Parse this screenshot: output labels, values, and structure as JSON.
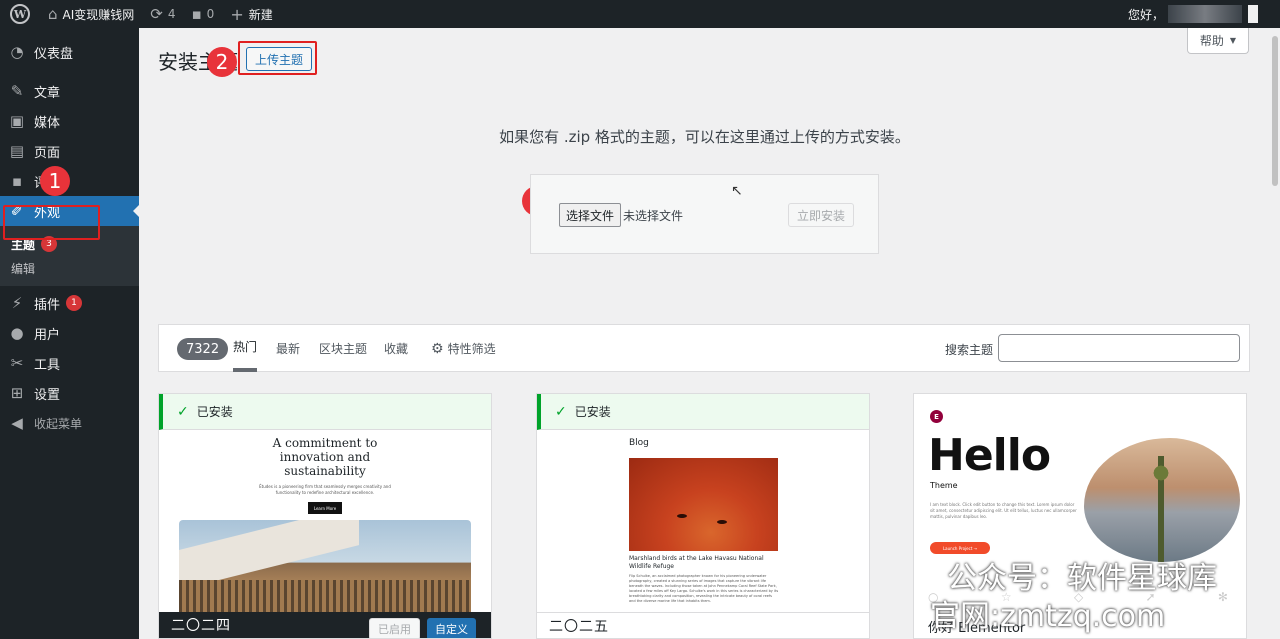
{
  "adminbar": {
    "site_name": "AI变现赚钱网",
    "updates_count": "4",
    "comments_count": "0",
    "new_label": "新建",
    "howdy": "您好，"
  },
  "sidebar": {
    "items": [
      {
        "label": "仪表盘",
        "icon": "dashboard-icon"
      },
      {
        "label": "文章",
        "icon": "pin-icon"
      },
      {
        "label": "媒体",
        "icon": "media-icon"
      },
      {
        "label": "页面",
        "icon": "page-icon"
      },
      {
        "label": "评",
        "icon": "comment-icon"
      },
      {
        "label": "外观",
        "icon": "brush-icon"
      },
      {
        "label": "插件",
        "icon": "plugin-icon",
        "badge": "1"
      },
      {
        "label": "用户",
        "icon": "user-icon"
      },
      {
        "label": "工具",
        "icon": "wrench-icon"
      },
      {
        "label": "设置",
        "icon": "settings-icon"
      },
      {
        "label": "收起菜单",
        "icon": "collapse-icon"
      }
    ],
    "submenu": [
      {
        "label": "主题",
        "badge": "3"
      },
      {
        "label": "编辑"
      }
    ]
  },
  "header": {
    "title": "安装主题",
    "upload_button": "上传主题",
    "help": "帮助"
  },
  "annotations": [
    "1",
    "2",
    "3"
  ],
  "upload": {
    "description": "如果您有 .zip 格式的主题，可以在这里通过上传的方式安装。",
    "choose_file": "选择文件",
    "no_file": "未选择文件",
    "install_now": "立即安装"
  },
  "filter": {
    "count": "7322",
    "tabs": [
      "热门",
      "最新",
      "区块主题",
      "收藏",
      "特性筛选"
    ],
    "search_label": "搜索主题"
  },
  "themes": [
    {
      "status": "已安装",
      "headline": "A commitment to innovation and sustainability",
      "subtext": "Études is a pioneering firm that seamlessly merges creativity and functionality to redefine architectural excellence.",
      "cta": "Learn More",
      "name": "二〇二四",
      "activated": "已启用",
      "customize": "自定义"
    },
    {
      "status": "已安装",
      "section": "Blog",
      "post_title": "Marshland birds at the Lake Havasu National Wildlife Refuge",
      "post_excerpt": "Flip Schulke, an acclaimed photographer known for his pioneering underwater photography, created a stunning series of images that capture the vibrant life beneath the waves. Including those taken at John Pennekamp Coral Reef State Park, located a few miles off Key Largo. Schulke's work in this series is characterized by its breathtaking clarity and composition, revealing the intricate beauty of coral reefs and the diverse marine life that inhabits them.",
      "name": "二〇二五"
    },
    {
      "logo": "E",
      "headline": "Hello",
      "subtitle": "Theme",
      "body": "I am text block. Click edit button to change this text. Lorem ipsum dolor sit amet, consectetur adipiscing elit. Ut elit tellus, luctus nec ullamcorper mattis, pulvinar dapibus leo.",
      "cta": "Launch Project →",
      "name": "你好 Elementor"
    }
  ],
  "watermark": {
    "line1": "公众号：软件星球库",
    "line2": "官网:zmtzq.com"
  },
  "colors": {
    "admin_dark": "#1d2327",
    "accent": "#2271b1",
    "annotation_red": "#e02020",
    "installed_green": "#00a32a",
    "badge_red": "#d63638"
  }
}
